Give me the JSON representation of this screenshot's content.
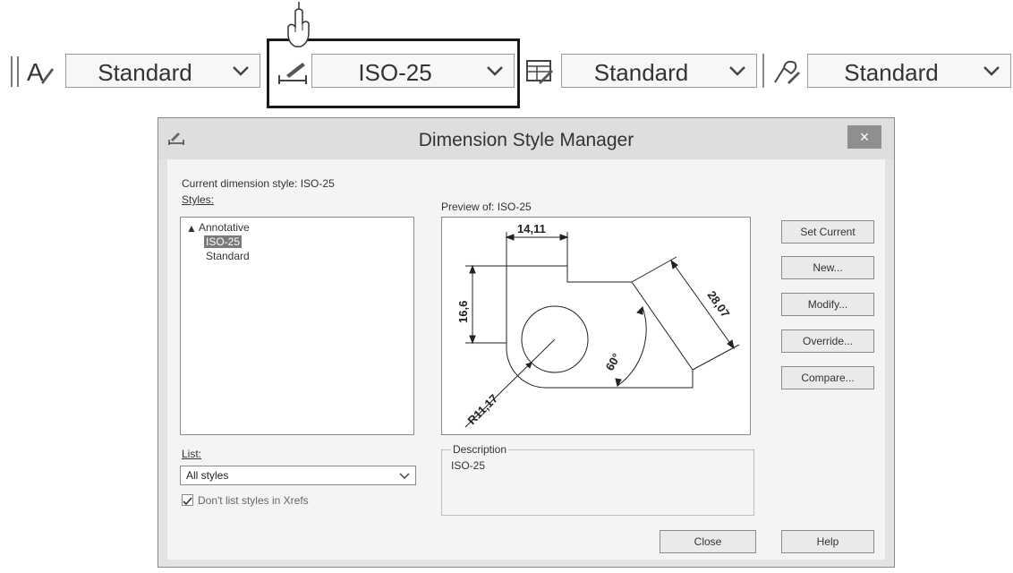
{
  "toolbar": {
    "text_style": "Standard",
    "dim_style": "ISO-25",
    "table_style": "Standard",
    "mleader_style": "Standard"
  },
  "dialog": {
    "title": "Dimension Style Manager",
    "close_glyph": "×",
    "current_style_label": "Current dimension style: ISO-25",
    "styles_label": "Styles:",
    "styles": [
      "Annotative",
      "ISO-25",
      "Standard"
    ],
    "selected_style": "ISO-25",
    "preview_label": "Preview of: ISO-25",
    "preview_dims": {
      "top": "14,11",
      "left": "16,6",
      "angle": "60°",
      "slant": "28,07",
      "radius": "R11,17"
    },
    "buttons": {
      "set_current": "Set Current",
      "new": "New...",
      "modify": "Modify...",
      "override": "Override...",
      "compare": "Compare...",
      "close": "Close",
      "help": "Help"
    },
    "list_label": "List:",
    "list_value": "All styles",
    "xrefs_label": "Don't list styles in Xrefs",
    "xrefs_checked": true,
    "description_label": "Description",
    "description_value": "ISO-25"
  },
  "icons": {
    "text_style": "text-style-icon",
    "dim_style": "dimension-style-icon",
    "table_style": "table-style-icon",
    "mleader_style": "multileader-style-icon",
    "pointer": "hand-pointer-icon"
  }
}
